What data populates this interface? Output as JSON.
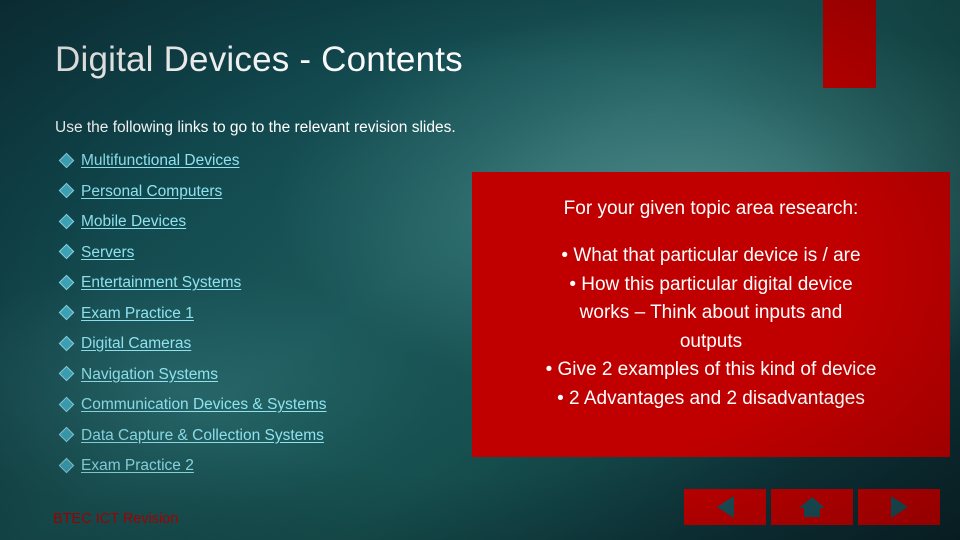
{
  "slide": {
    "title": "Digital Devices - Contents",
    "intro": "Use the following links to go to the relevant revision slides.",
    "links": [
      "Multifunctional Devices",
      "Personal Computers",
      "Mobile Devices",
      "Servers",
      "Entertainment Systems",
      "Exam Practice 1",
      "Digital Cameras",
      "Navigation Systems",
      "Communication Devices & Systems",
      "Data Capture & Collection Systems",
      "Exam Practice 2"
    ],
    "redbox": {
      "headline": "For your given topic area research:",
      "lines": [
        "•  What that particular device is / are",
        "•  How this particular digital device",
        "works – Think about inputs and",
        "outputs",
        "•  Give 2 examples of this kind of device",
        "•  2 Advantages and 2 disadvantages"
      ]
    },
    "footer": "BTEC ICT Revision",
    "nav": {
      "prev_icon": "triangle-left-icon",
      "home_icon": "home-icon",
      "next_icon": "triangle-right-icon"
    },
    "colors": {
      "accent_red": "#c00000",
      "link": "#8fe3ef",
      "text": "#ffffff"
    }
  }
}
